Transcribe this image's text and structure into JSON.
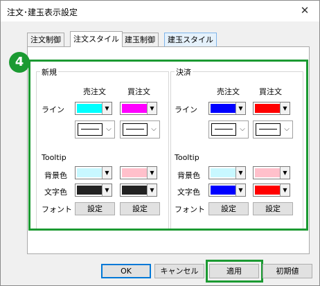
{
  "window": {
    "title": "注文･建玉表示設定",
    "close_glyph": "✕"
  },
  "tabs": [
    {
      "label": "注文制御"
    },
    {
      "label": "注文スタイル"
    },
    {
      "label": "建玉制御"
    },
    {
      "label": "建玉スタイル"
    }
  ],
  "callout_number": "4",
  "new_group": {
    "legend": "新規",
    "col_sell": "売注文",
    "col_buy": "買注文",
    "line_label": "ライン",
    "line_colors": {
      "sell": "#00ffff",
      "buy": "#ff00ff"
    },
    "tooltip_label": "Tooltip",
    "bg_label": "背景色",
    "bg_colors": {
      "sell": "#c8f8ff",
      "buy": "#ffc0cb"
    },
    "text_label": "文字色",
    "text_colors": {
      "sell": "#222222",
      "buy": "#222222"
    },
    "font_label": "フォント",
    "font_button": "設定"
  },
  "settle_group": {
    "legend": "決済",
    "col_sell": "売注文",
    "col_buy": "買注文",
    "line_label": "ライン",
    "line_colors": {
      "sell": "#0000ff",
      "buy": "#ff0000"
    },
    "tooltip_label": "Tooltip",
    "bg_label": "背景色",
    "bg_colors": {
      "sell": "#c8f8ff",
      "buy": "#ffc0cb"
    },
    "text_label": "文字色",
    "text_colors": {
      "sell": "#0000ff",
      "buy": "#ff0000"
    },
    "font_label": "フォント",
    "font_button": "設定"
  },
  "footer": {
    "ok": "OK",
    "cancel": "キャンセル",
    "apply": "適用",
    "reset": "初期値"
  },
  "accent_color": "#1b9a32"
}
